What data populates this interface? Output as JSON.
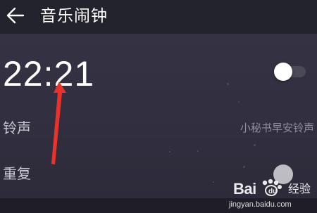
{
  "header": {
    "title": "音乐闹钟",
    "back_icon": "arrow-left-icon"
  },
  "alarm": {
    "time": "22:21",
    "enabled": true
  },
  "ringtone": {
    "label": "铃声",
    "value": "小秘书早安铃声"
  },
  "repeat": {
    "label": "重复"
  },
  "watermark": {
    "brand_left": "Bai",
    "brand_right": "经验",
    "url": "jingyan.baidu.com"
  },
  "colors": {
    "topbar": "#23232e",
    "background": "#312f3f",
    "annotation_arrow": "#e8322a"
  }
}
